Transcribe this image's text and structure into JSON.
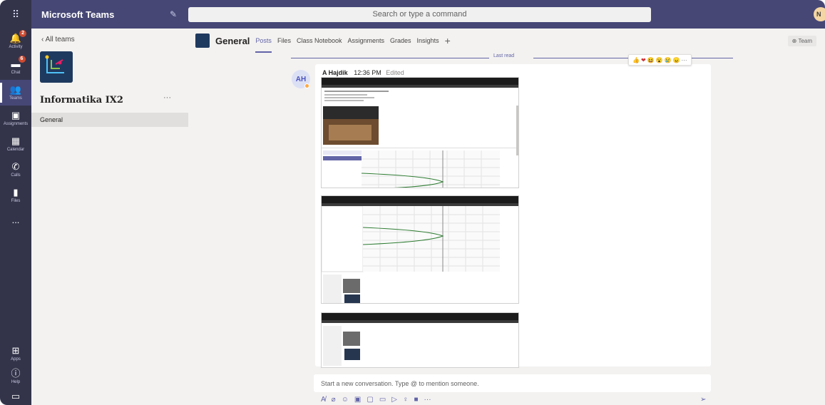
{
  "topbar": {
    "app_title": "Microsoft Teams",
    "search_placeholder": "Search or type a command",
    "avatar_initial": "N"
  },
  "rail": {
    "items": [
      {
        "label": "Activity",
        "icon": "bell-icon",
        "badge": "2"
      },
      {
        "label": "Chat",
        "icon": "chat-icon",
        "badge": "6"
      },
      {
        "label": "Teams",
        "icon": "teams-icon"
      },
      {
        "label": "Assignments",
        "icon": "assignments-icon"
      },
      {
        "label": "Calendar",
        "icon": "calendar-icon"
      },
      {
        "label": "Calls",
        "icon": "phone-icon"
      },
      {
        "label": "Files",
        "icon": "files-icon"
      },
      {
        "label": "...",
        "icon": "more-icon"
      },
      {
        "label": "Apps",
        "icon": "apps-icon"
      },
      {
        "label": "Help",
        "icon": "help-icon"
      }
    ]
  },
  "team_panel": {
    "back_label": "All teams",
    "team_name": "Informatika IX2",
    "more": "···",
    "channels": [
      "General"
    ]
  },
  "channel": {
    "name": "General",
    "tabs": [
      "Posts",
      "Files",
      "Class Notebook",
      "Assignments",
      "Grades",
      "Insights"
    ],
    "add_tab": "+",
    "team_button": "⊕ Team",
    "last_read": "Last read"
  },
  "message": {
    "avatar_initials": "AH",
    "author": "A Hajdik",
    "time": "12:36 PM",
    "edited": "Edited",
    "reactions": [
      "👍",
      "❤",
      "😆",
      "😮",
      "😢",
      "😠",
      "···"
    ]
  },
  "compose": {
    "placeholder": "Start a new conversation. Type @ to mention someone."
  },
  "colors": {
    "topbar": "#464775",
    "rail": "#33344a",
    "accent": "#6264a7",
    "panel": "#f3f2f1"
  }
}
